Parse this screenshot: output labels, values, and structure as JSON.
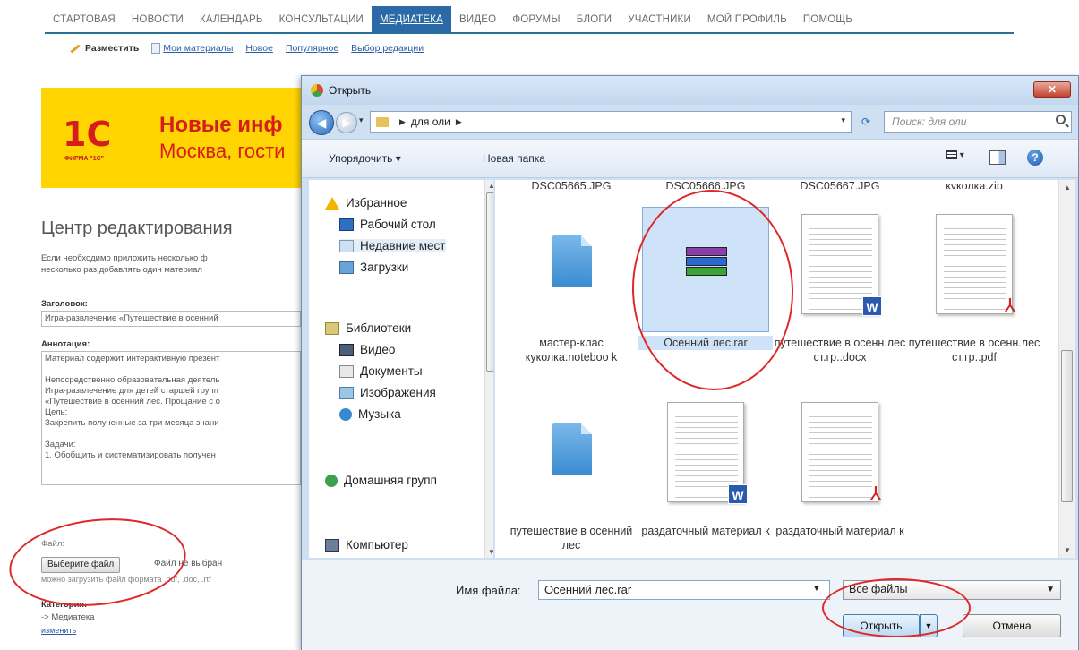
{
  "page": {
    "nav": [
      "СТАРТОВАЯ",
      "НОВОСТИ",
      "КАЛЕНДАРЬ",
      "КОНСУЛЬТАЦИИ",
      "МЕДИАТЕКА",
      "ВИДЕО",
      "ФОРУМЫ",
      "БЛОГИ",
      "УЧАСТНИКИ",
      "МОЙ ПРОФИЛЬ",
      "ПОМОЩЬ"
    ],
    "subnav": {
      "post": "Разместить",
      "my_materials": "Мои материалы",
      "new": "Новое",
      "popular": "Популярное",
      "editors_choice": "Выбор редакции"
    },
    "banner": {
      "logo": "1С",
      "logo_sub": "ФИРМА \"1С\"",
      "line1": "Новые инф",
      "line2": "Москва, гости"
    },
    "title": "Центр редактирования",
    "intro": [
      "Если необходимо приложить несколько ф",
      "несколько раз добавлять один материал"
    ],
    "heading_label": "Заголовок:",
    "heading_value": "Игра-развлечение «Путешествие в осенний",
    "annotation_label": "Аннотация:",
    "annotation_lines": [
      "Материал содержит интерактивную презент",
      "",
      "Непосредственно образовательная деятель",
      "Игра-развлечение для детей старшей групп",
      "«Путешествие в осенний лес. Прощание с о",
      "Цель:",
      "Закрепить полученные за три месяца знани",
      "",
      "Задачи:",
      "1.    Обобщить и систематизировать получен"
    ],
    "file_label": "Файл:",
    "file_button": "Выберите файл",
    "file_status": "Файл не выбран",
    "file_hint": "можно загрузить файл формата .pdf, .doc, .rtf",
    "category_label": "Категория:",
    "category_value": "-> Медиатека",
    "category_change": "изменить"
  },
  "dialog": {
    "title": "Открыть",
    "close": "✕",
    "path": [
      "для оли"
    ],
    "search_placeholder": "Поиск: для оли",
    "toolbar": {
      "organize": "Упорядочить ▾",
      "new_folder": "Новая папка"
    },
    "nav": {
      "favorites": "Избранное",
      "desktop": "Рабочий стол",
      "recent": "Недавние мест",
      "downloads": "Загрузки",
      "libraries": "Библиотеки",
      "video": "Видео",
      "documents": "Документы",
      "images": "Изображения",
      "music": "Музыка",
      "homegroup": "Домашняя групп",
      "computer": "Компьютер"
    },
    "top_row": [
      "DSC05665.JPG",
      "DSC05666.JPG",
      "DSC05667.JPG",
      "куколка.zip"
    ],
    "files": [
      {
        "name": "мастер-клас куколка.noteboo k",
        "icon": "notebook-file-icon"
      },
      {
        "name": "Осенний лес.rar",
        "icon": "winrar-archive-icon"
      },
      {
        "name": "путешествие в осенн.лес ст.гр..docx",
        "icon": "word-document-icon"
      },
      {
        "name": "путешествие в осенн.лес ст.гр..pdf",
        "icon": "pdf-document-icon"
      },
      {
        "name": "путешествие в осенний лес",
        "icon": "notebook-file-icon"
      },
      {
        "name": "раздаточный материал к",
        "icon": "word-document-icon"
      },
      {
        "name": "раздаточный материал к",
        "icon": "pdf-document-icon"
      }
    ],
    "filename_label": "Имя файла:",
    "filename_value": "Осенний лес.rar",
    "filter": "Все файлы",
    "open": "Открыть",
    "cancel": "Отмена"
  }
}
